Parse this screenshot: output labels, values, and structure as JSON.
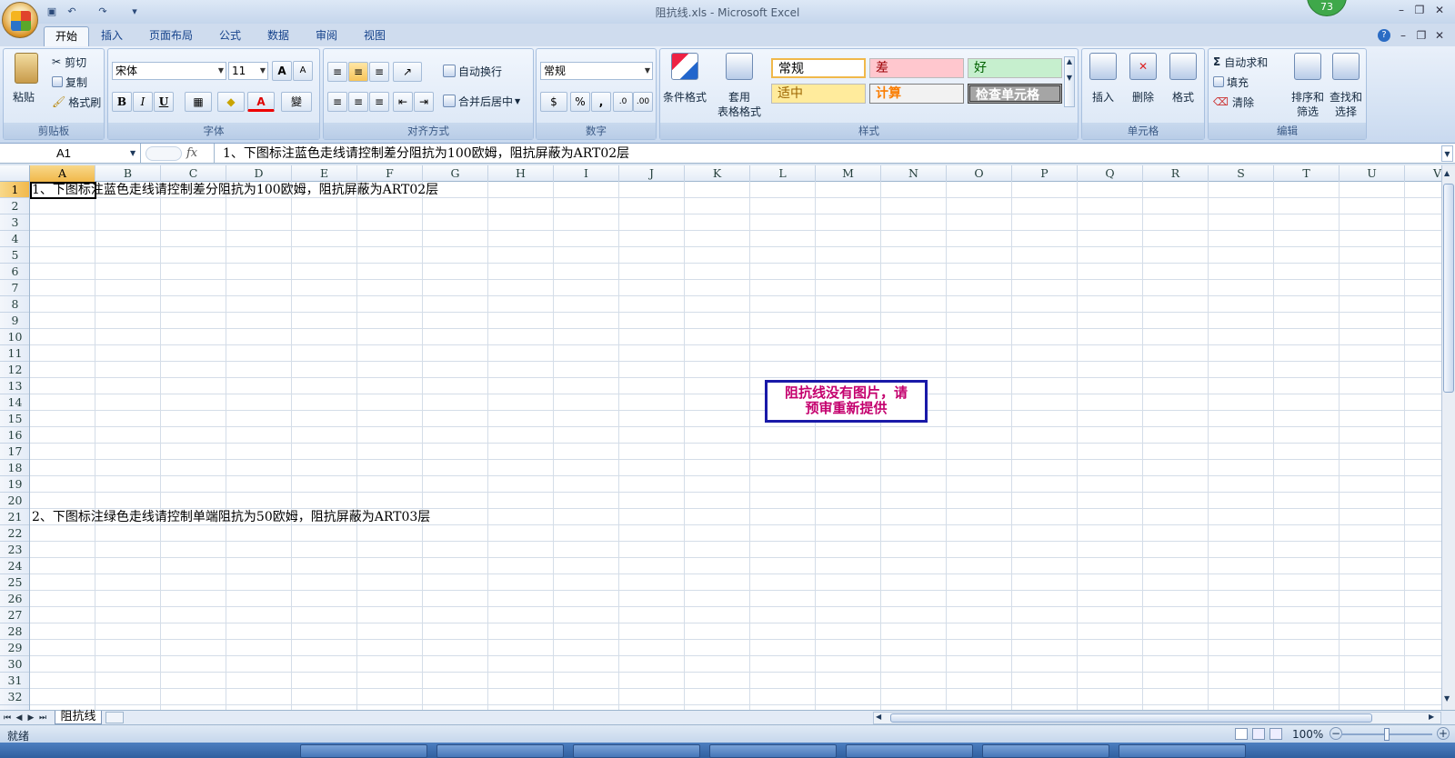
{
  "window": {
    "title": "阻抗线.xls - Microsoft Excel",
    "badge": "73"
  },
  "quick_access": {
    "save_icon": "save-icon",
    "undo_icon": "undo-icon",
    "redo_icon": "redo-icon"
  },
  "tabs": [
    "开始",
    "插入",
    "页面布局",
    "公式",
    "数据",
    "审阅",
    "视图"
  ],
  "active_tab": "开始",
  "ribbon": {
    "clipboard": {
      "label": "剪贴板",
      "paste": "粘贴",
      "cut": "剪切",
      "copy": "复制",
      "format_painter": "格式刷"
    },
    "font": {
      "label": "字体",
      "font_name": "宋体",
      "font_size": "11",
      "bold": "B",
      "italic": "I",
      "underline": "U",
      "grow": "A",
      "shrink": "A",
      "font_color_letter": "A",
      "phonetic": "變"
    },
    "alignment": {
      "label": "对齐方式",
      "wrap_text": "自动换行",
      "merge_center": "合并后居中"
    },
    "number": {
      "label": "数字",
      "format": "常规",
      "percent": "%",
      "comma": ","
    },
    "styles": {
      "label": "样式",
      "conditional": "条件格式",
      "table_format_1": "套用",
      "table_format_2": "表格格式",
      "normal": "常规",
      "bad": "差",
      "good": "好",
      "neutral": "适中",
      "calculation": "计算",
      "check_cell": "检查单元格"
    },
    "cells": {
      "label": "单元格",
      "insert": "插入",
      "delete": "删除",
      "format": "格式"
    },
    "editing": {
      "label": "编辑",
      "autosum": "自动求和",
      "fill": "填充",
      "clear": "清除",
      "sort_1": "排序和",
      "sort_2": "筛选",
      "find_1": "查找和",
      "find_2": "选择"
    }
  },
  "formula_bar": {
    "name_box": "A1",
    "fx": "fx",
    "content": "1、下图标注蓝色走线请控制差分阻抗为100欧姆，阻抗屏蔽为ART02层"
  },
  "columns": [
    "A",
    "B",
    "C",
    "D",
    "E",
    "F",
    "G",
    "H",
    "I",
    "J",
    "K",
    "L",
    "M",
    "N",
    "O",
    "P",
    "Q",
    "R",
    "S",
    "T",
    "U",
    "V"
  ],
  "rows": [
    "1",
    "2",
    "3",
    "4",
    "5",
    "6",
    "7",
    "8",
    "9",
    "10",
    "11",
    "12",
    "13",
    "14",
    "15",
    "16",
    "17",
    "18",
    "19",
    "20",
    "21",
    "22",
    "23",
    "24",
    "25",
    "26",
    "27",
    "28",
    "29",
    "30",
    "31",
    "32"
  ],
  "cells": {
    "A1": "1、下图标注蓝色走线请控制差分阻抗为100欧姆，阻抗屏蔽为ART02层",
    "A21": "2、下图标注绿色走线请控制单端阻抗为50欧姆，阻抗屏蔽为ART03层"
  },
  "note_box": {
    "line1": "阻抗线没有图片，请",
    "line2": "预审重新提供"
  },
  "sheet_tabs": [
    "阻抗线"
  ],
  "status": {
    "ready": "就绪",
    "zoom": "100%"
  }
}
